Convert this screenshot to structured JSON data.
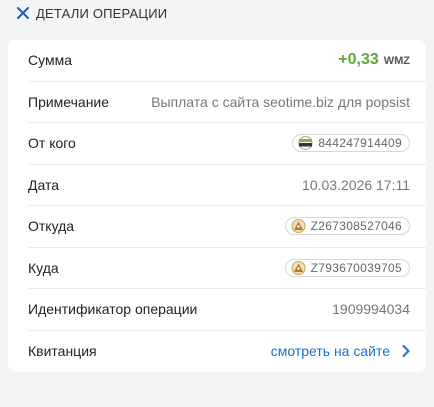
{
  "header": {
    "title": "ДЕТАЛИ ОПЕРАЦИИ"
  },
  "rows": {
    "amount": {
      "label": "Сумма",
      "value": "+0,33",
      "currency": "WMZ"
    },
    "note": {
      "label": "Примечание",
      "value": "Выплата с сайта seotime.biz для popsist"
    },
    "from": {
      "label": "От кого",
      "value": "844247914409",
      "icon": "seo-time-logo-icon"
    },
    "date": {
      "label": "Дата",
      "value": "10.03.2026 17:11"
    },
    "source": {
      "label": "Откуда",
      "value": "Z267308527046",
      "icon": "wallet-pyramid-icon"
    },
    "dest": {
      "label": "Куда",
      "value": "Z793670039705",
      "icon": "wallet-pyramid-icon"
    },
    "opid": {
      "label": "Идентификатор операции",
      "value": "1909994034"
    },
    "receipt": {
      "label": "Квитанция",
      "value": "смотреть на сайте"
    }
  },
  "colors": {
    "amount_positive": "#5da83a",
    "link": "#1a73c8"
  }
}
